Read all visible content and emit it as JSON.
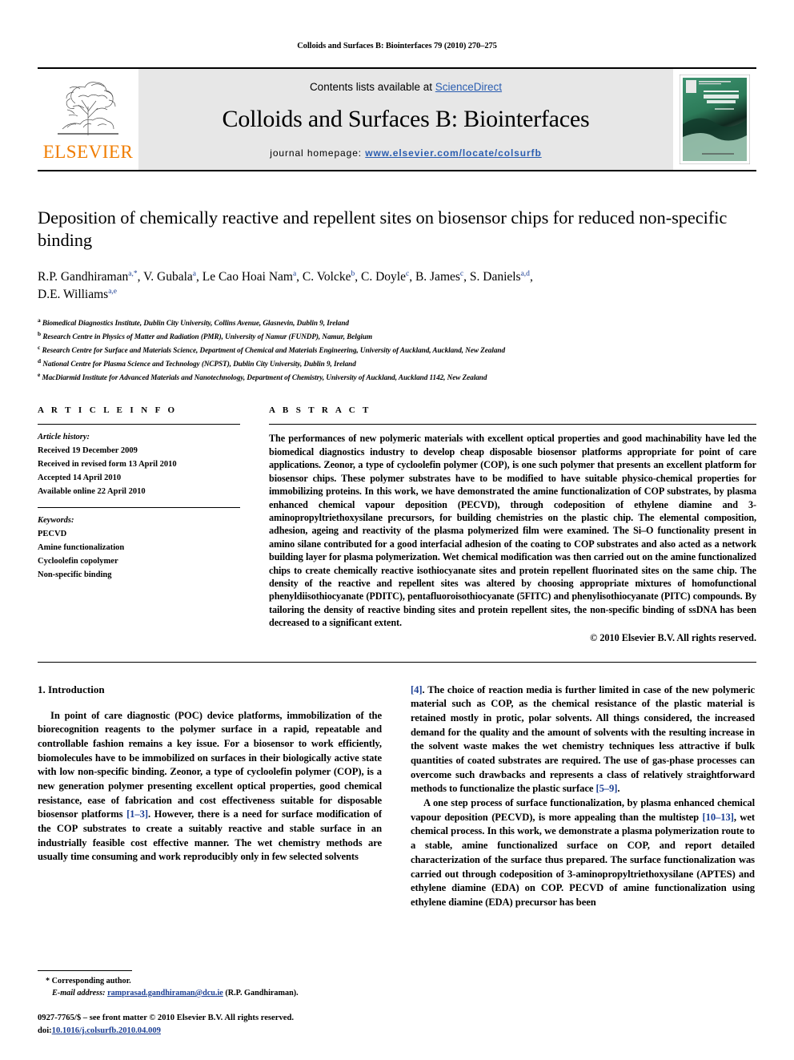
{
  "running_head": "Colloids and Surfaces B: Biointerfaces 79 (2010) 270–275",
  "masthead": {
    "publisher_name": "ELSEVIER",
    "contents_prefix": "Contents lists available at ",
    "contents_link": "ScienceDirect",
    "journal_title": "Colloids and Surfaces B: Biointerfaces",
    "homepage_label": "journal homepage:",
    "homepage_url": "www.elsevier.com/locate/colsurfb",
    "cover_title_line1": "COLLOIDS AND",
    "cover_title_line2": "SURFACES B",
    "accent_orange": "#f07d00",
    "link_blue": "#2a5db0",
    "cover_green": "#2e7d5b"
  },
  "article": {
    "title": "Deposition of chemically reactive and repellent sites on biosensor chips for reduced non-specific binding",
    "authors_line1": "R.P. Gandhiraman",
    "authors": "R.P. Gandhiraman a,*, V. Gubala a, Le Cao Hoai Nam a, C. Volcke b, C. Doyle c, B. James c, S. Daniels a,d, D.E. Williams a,e",
    "affiliations": [
      {
        "mark": "a",
        "text": "Biomedical Diagnostics Institute, Dublin City University, Collins Avenue, Glasnevin, Dublin 9, Ireland"
      },
      {
        "mark": "b",
        "text": "Research Centre in Physics of Matter and Radiation (PMR), University of Namur (FUNDP), Namur, Belgium"
      },
      {
        "mark": "c",
        "text": "Research Centre for Surface and Materials Science, Department of Chemical and Materials Engineering, University of Auckland, Auckland, New Zealand"
      },
      {
        "mark": "d",
        "text": "National Centre for Plasma Science and Technology (NCPST), Dublin City University, Dublin 9, Ireland"
      },
      {
        "mark": "e",
        "text": "MacDiarmid Institute for Advanced Materials and Nanotechnology, Department of Chemistry, University of Auckland, Auckland 1142, New Zealand"
      }
    ]
  },
  "article_info": {
    "heading": "A R T I C L E   I N F O",
    "history_label": "Article history:",
    "history": [
      "Received 19 December 2009",
      "Received in revised form 13 April 2010",
      "Accepted 14 April 2010",
      "Available online 22 April 2010"
    ],
    "keywords_label": "Keywords:",
    "keywords": [
      "PECVD",
      "Amine functionalization",
      "Cycloolefin copolymer",
      "Non-specific binding"
    ]
  },
  "abstract": {
    "heading": "A B S T R A C T",
    "text": "The performances of new polymeric materials with excellent optical properties and good machinability have led the biomedical diagnostics industry to develop cheap disposable biosensor platforms appropriate for point of care applications. Zeonor, a type of cycloolefin polymer (COP), is one such polymer that presents an excellent platform for biosensor chips. These polymer substrates have to be modified to have suitable physico-chemical properties for immobilizing proteins. In this work, we have demonstrated the amine functionalization of COP substrates, by plasma enhanced chemical vapour deposition (PECVD), through codeposition of ethylene diamine and 3-aminopropyltriethoxysilane precursors, for building chemistries on the plastic chip. The elemental composition, adhesion, ageing and reactivity of the plasma polymerized film were examined. The Si–O functionality present in amino silane contributed for a good interfacial adhesion of the coating to COP substrates and also acted as a network building layer for plasma polymerization. Wet chemical modification was then carried out on the amine functionalized chips to create chemically reactive isothiocyanate sites and protein repellent fluorinated sites on the same chip. The density of the reactive and repellent sites was altered by choosing appropriate mixtures of homofunctional phenyldiisothiocyanate (PDITC), pentafluoroisothiocyanate (5FITC) and phenylisothiocyanate (PITC) compounds. By tailoring the density of reactive binding sites and protein repellent sites, the non-specific binding of ssDNA has been decreased to a significant extent.",
    "copyright": "© 2010 Elsevier B.V. All rights reserved."
  },
  "body": {
    "section_heading": "1.  Introduction",
    "left_para_1_a": "In point of care diagnostic (POC) device platforms, immobilization of the biorecognition reagents to the polymer surface in a rapid, repeatable and controllable fashion remains a key issue. For a biosensor to work efficiently, biomolecules have to be immobilized on surfaces in their biologically active state with low non-specific binding. Zeonor, a type of cycloolefin polymer (COP), is a new generation polymer presenting excellent optical properties, good chemical resistance, ease of fabrication and cost effectiveness suitable for disposable biosensor platforms ",
    "left_ref_1": "[1–3]",
    "left_para_1_b": ". However, there is a need for surface modification of the COP substrates to create a suitably reactive and stable surface in an industrially feasible cost effective manner. The wet chemistry methods are usually time consuming and work reproducibly only in few selected solvents",
    "right_ref_1": "[4]",
    "right_para_1": ". The choice of reaction media is further limited in case of the new polymeric material such as COP, as the chemical resistance of the plastic material is retained mostly in protic, polar solvents. All things considered, the increased demand for the quality and the amount of solvents with the resulting increase in the solvent waste makes the wet chemistry techniques less attractive if bulk quantities of coated substrates are required. The use of gas-phase processes can overcome such drawbacks and represents a class of relatively straightforward methods to functionalize the plastic surface ",
    "right_ref_2": "[5–9]",
    "right_para_1_end": ".",
    "right_para_2_a": "A one step process of surface functionalization, by plasma enhanced chemical vapour deposition (PECVD), is more appealing than the multistep ",
    "right_ref_3": "[10–13]",
    "right_para_2_b": ", wet chemical process. In this work, we demonstrate a plasma polymerization route to a stable, amine functionalized surface on COP, and report detailed characterization of the surface thus prepared. The surface functionalization was carried out through codeposition of 3-aminopropyltriethoxysilane (APTES) and ethylene diamine (EDA) on COP. PECVD of amine functionalization using ethylene diamine (EDA) precursor has been"
  },
  "footnote": {
    "corresponding": "* Corresponding author.",
    "email_label": "E-mail address:",
    "email": "ramprasad.gandhiraman@dcu.ie",
    "email_suffix": "(R.P. Gandhiraman).",
    "issn_line": "0927-7765/$ – see front matter © 2010 Elsevier B.V. All rights reserved.",
    "doi_label": "doi:",
    "doi": "10.1016/j.colsurfb.2010.04.009"
  }
}
